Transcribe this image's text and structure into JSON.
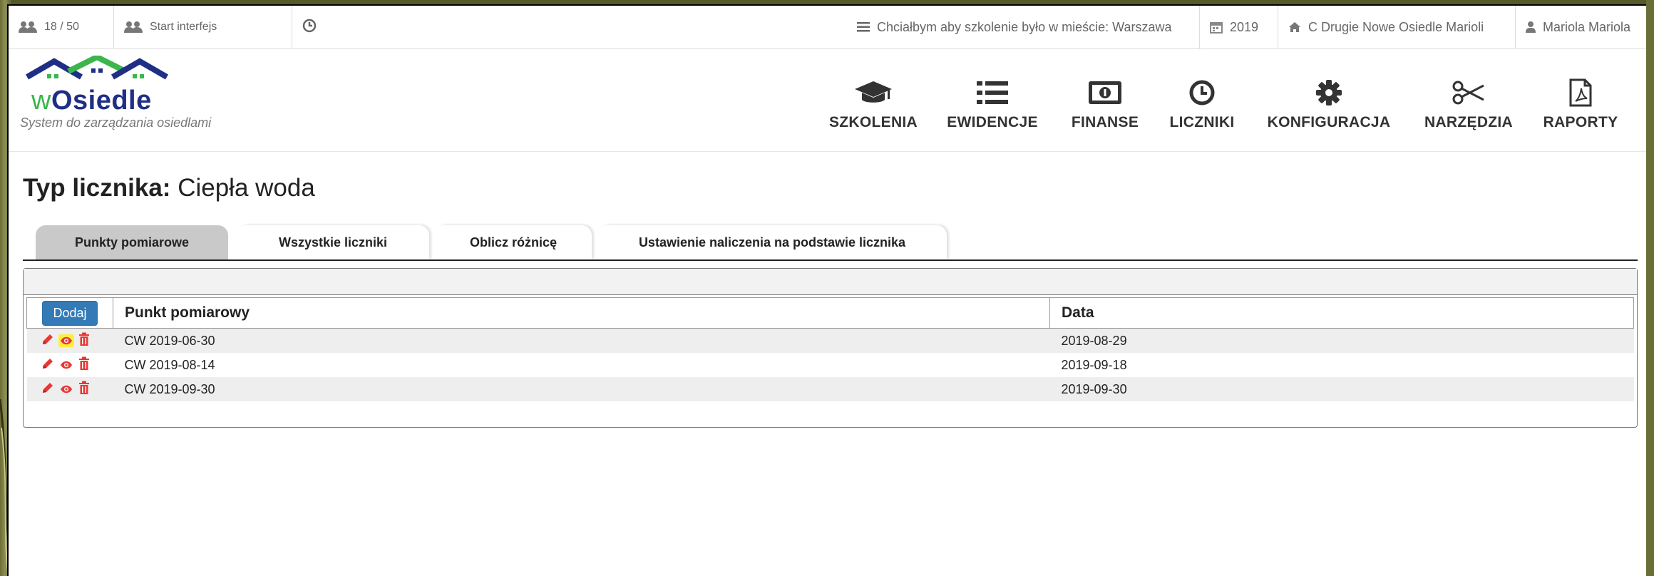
{
  "topbar": {
    "counter": "18 / 50",
    "start": "Start interfejs",
    "training_wish": "Chciałbym aby szkolenie było w mieście: Warszawa",
    "year": "2019",
    "estate": "C Drugie Nowe Osiedle Marioli",
    "user": "Mariola Mariola"
  },
  "logo": {
    "name_w": "w",
    "name_rest": "Osiedle",
    "subtitle": "System do zarządzania osiedlami"
  },
  "nav": [
    {
      "label": "SZKOLENIA",
      "icon": "graduation-cap-icon"
    },
    {
      "label": "EWIDENCJE",
      "icon": "list-icon"
    },
    {
      "label": "FINANSE",
      "icon": "money-icon"
    },
    {
      "label": "LICZNIKI",
      "icon": "clock-icon"
    },
    {
      "label": "KONFIGURACJA",
      "icon": "gear-icon"
    },
    {
      "label": "NARZĘDZIA",
      "icon": "scissors-icon"
    },
    {
      "label": "RAPORTY",
      "icon": "pdf-icon"
    }
  ],
  "page": {
    "title_label": "Typ licznika:",
    "title_value": "Ciepła woda"
  },
  "tabs": [
    "Punkty pomiarowe",
    "Wszystkie liczniki",
    "Oblicz różnicę",
    "Ustawienie naliczenia na podstawie licznika"
  ],
  "table": {
    "add_label": "Dodaj",
    "columns": [
      "Punkt pomiarowy",
      "Data"
    ],
    "rows": [
      {
        "point": "CW 2019-06-30",
        "date": "2019-08-29"
      },
      {
        "point": "CW 2019-08-14",
        "date": "2019-09-18"
      },
      {
        "point": "CW 2019-09-30",
        "date": "2019-09-30"
      }
    ]
  },
  "colors": {
    "accent_blue": "#337ab7",
    "action_red": "#e53935",
    "highlight": "#ffef3a",
    "logo_navy": "#1f2f86",
    "logo_green": "#3bb64b"
  }
}
